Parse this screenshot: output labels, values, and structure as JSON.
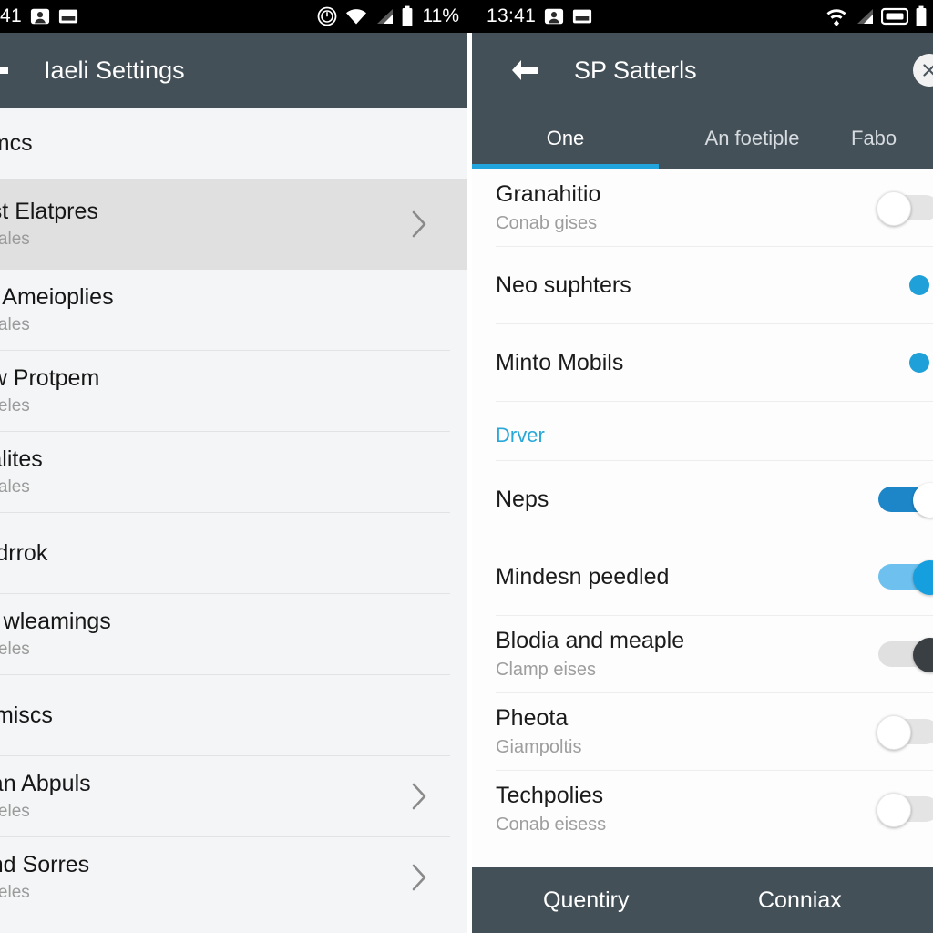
{
  "status_bar": {
    "left": {
      "clock": "41",
      "battery_percent": "11%",
      "icons": [
        "contact-notification-icon",
        "image-notification-icon",
        "dnd-clock-icon",
        "wifi-icon",
        "cellular-signal-icon",
        "battery-icon"
      ]
    },
    "right": {
      "clock": "13:41",
      "icons": [
        "contact-notification-icon",
        "image-notification-icon",
        "wifi-icon",
        "cellular-signal-icon",
        "screen-cast-icon",
        "battery-icon"
      ]
    }
  },
  "left_app": {
    "title": "Iaeli Settings",
    "back_icon": "back-arrow-icon",
    "section_header": "et mcs",
    "items": [
      {
        "title": "oest Elatpres",
        "subtitle": "dh sales",
        "chevron": true,
        "selected": true
      },
      {
        "title": "om Ameioplies",
        "subtitle": "dh sales",
        "chevron": false,
        "selected": false
      },
      {
        "title": "how Protpem",
        "subtitle": "dh seles",
        "chevron": false,
        "selected": false
      },
      {
        "title": "nvalites",
        "subtitle": "dh sales",
        "chevron": false,
        "selected": false
      },
      {
        "title": "oledrrok",
        "subtitle": "",
        "chevron": false,
        "selected": false
      },
      {
        "title": "em wleamings",
        "subtitle": "dh seles",
        "chevron": false,
        "selected": false
      },
      {
        "title": "lusmiscs",
        "subtitle": "",
        "chevron": false,
        "selected": false
      },
      {
        "title": "dean Abpuls",
        "subtitle": "dh seles",
        "chevron": true,
        "selected": false
      },
      {
        "title": "irand Sorres",
        "subtitle": "dh seles",
        "chevron": true,
        "selected": false
      }
    ]
  },
  "right_app": {
    "title": "SP Satterls",
    "back_icon": "back-arrow-icon",
    "close_icon": "close-icon",
    "tabs": [
      {
        "label": "One",
        "active": true
      },
      {
        "label": "An foetiple",
        "active": false
      },
      {
        "label": "Fabo",
        "active": false
      }
    ],
    "items": [
      {
        "title": "Granahitio",
        "subtitle": "Conab gises",
        "control": "toggle-off"
      },
      {
        "title": "Neo suphters",
        "subtitle": "",
        "control": "radio-on"
      },
      {
        "title": "Minto Mobils",
        "subtitle": "",
        "control": "radio-on"
      }
    ],
    "section_label": "Drver",
    "items2": [
      {
        "title": "Neps",
        "subtitle": "",
        "control": "toggle-on"
      },
      {
        "title": "Mindesn peedled",
        "subtitle": "",
        "control": "toggle-on-light"
      },
      {
        "title": "Blodia and meaple",
        "subtitle": "Clamp eises",
        "control": "toggle-dark"
      },
      {
        "title": "Pheota",
        "subtitle": "Giampoltis",
        "control": "toggle-off"
      },
      {
        "title": "Techpolies",
        "subtitle": "Conab eisess",
        "control": "toggle-off"
      }
    ],
    "bottom_bar": {
      "left_button": "Quentiry",
      "right_button": "Conniax"
    }
  },
  "colors": {
    "appbar": "#445058",
    "accent": "#22a5dc",
    "section_label": "#29a8d8",
    "toggle_on": "#1c86c8",
    "toggle_on_light": "#6ec1ee",
    "radio": "#1fa0d8",
    "selected_row": "#e0e0e0"
  }
}
